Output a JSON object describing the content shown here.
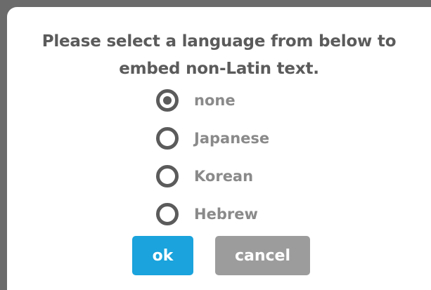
{
  "dialog": {
    "prompt_line1": "Please select a language from below to",
    "prompt_line2": "embed non-Latin text.",
    "options": [
      {
        "label": "none",
        "selected": true
      },
      {
        "label": "Japanese",
        "selected": false
      },
      {
        "label": "Korean",
        "selected": false
      },
      {
        "label": "Hebrew",
        "selected": false
      }
    ],
    "ok_label": "ok",
    "cancel_label": "cancel"
  },
  "colors": {
    "backdrop": "#6b6b6b",
    "dialog_background": "#ffffff",
    "prompt_text": "#5b5b5b",
    "radio": "#5b5b5b",
    "option_text": "#8a8a8a",
    "ok_button": "#1aa3dc",
    "cancel_button": "#9c9c9c"
  },
  "icons": {
    "radio_selected": "radio-checked-icon",
    "radio_unselected": "radio-unchecked-icon"
  }
}
